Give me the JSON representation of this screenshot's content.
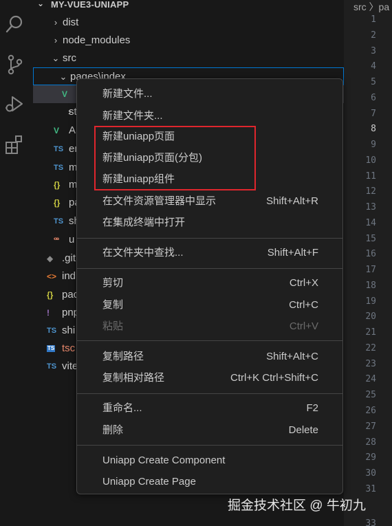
{
  "explorer": {
    "project_title": "MY-VUE3-UNIAPP",
    "rows": [
      {
        "label": "dist",
        "chevron": "›"
      },
      {
        "label": "node_modules",
        "chevron": "›"
      },
      {
        "label": "src",
        "chevron": "⌄"
      },
      {
        "label": "pages\\index",
        "chevron": "⌄"
      },
      {
        "label": "",
        "icon": "vue-icon"
      },
      {
        "label": "st",
        "chevron": "›"
      },
      {
        "label": "A",
        "icon": "vue-icon"
      },
      {
        "label": "en",
        "icon": "ts-icon"
      },
      {
        "label": "m",
        "icon": "ts-icon"
      },
      {
        "label": "m",
        "icon": "json-icon"
      },
      {
        "label": "pa",
        "icon": "json-icon"
      },
      {
        "label": "sh",
        "icon": "ts-icon"
      },
      {
        "label": "u",
        "icon": "scss-icon"
      },
      {
        "label": ".git",
        "icon": "git-icon"
      },
      {
        "label": "ind",
        "icon": "html-icon"
      },
      {
        "label": "pac",
        "icon": "json-icon"
      },
      {
        "label": "pnp",
        "icon": "yaml-icon"
      },
      {
        "label": "shi",
        "icon": "ts-icon"
      },
      {
        "label": "tsc",
        "icon": "tsconfig-icon"
      },
      {
        "label": "vite",
        "icon": "ts-icon"
      }
    ],
    "icon_text": {
      "ts": "TS",
      "json": "{}",
      "vue": "V",
      "html": "<>",
      "yaml": "!",
      "git": "◆",
      "scss": "ꟹ"
    }
  },
  "editor": {
    "breadcrumb": "src 〉pa",
    "line_numbers": [
      "1",
      "2",
      "3",
      "4",
      "5",
      "6",
      "7",
      "8",
      "9",
      "10",
      "11",
      "12",
      "13",
      "14",
      "15",
      "16",
      "17",
      "18",
      "19",
      "20",
      "21",
      "22",
      "23",
      "24",
      "25",
      "26",
      "27",
      "28",
      "29",
      "30",
      "31",
      "33"
    ],
    "active_line": "8"
  },
  "context_menu": {
    "groups": [
      [
        {
          "label": "新建文件...",
          "shortcut": ""
        },
        {
          "label": "新建文件夹...",
          "shortcut": ""
        },
        {
          "label": "新建uniapp页面",
          "shortcut": ""
        },
        {
          "label": "新建uniapp页面(分包)",
          "shortcut": ""
        },
        {
          "label": "新建uniapp组件",
          "shortcut": ""
        },
        {
          "label": "在文件资源管理器中显示",
          "shortcut": "Shift+Alt+R"
        },
        {
          "label": "在集成终端中打开",
          "shortcut": ""
        }
      ],
      [
        {
          "label": "在文件夹中查找...",
          "shortcut": "Shift+Alt+F"
        }
      ],
      [
        {
          "label": "剪切",
          "shortcut": "Ctrl+X"
        },
        {
          "label": "复制",
          "shortcut": "Ctrl+C"
        },
        {
          "label": "粘贴",
          "shortcut": "Ctrl+V",
          "disabled": true
        }
      ],
      [
        {
          "label": "复制路径",
          "shortcut": "Shift+Alt+C"
        },
        {
          "label": "复制相对路径",
          "shortcut": "Ctrl+K Ctrl+Shift+C"
        }
      ],
      [
        {
          "label": "重命名...",
          "shortcut": "F2"
        },
        {
          "label": "删除",
          "shortcut": "Delete"
        }
      ],
      [
        {
          "label": "Uniapp Create Component",
          "shortcut": ""
        },
        {
          "label": "Uniapp Create Page",
          "shortcut": ""
        }
      ]
    ]
  },
  "watermark": "掘金技术社区 @ 牛初九",
  "colors": {
    "focus_border": "#0078d4",
    "highlight_box": "#e0262d",
    "background": "#1f1f1f"
  }
}
